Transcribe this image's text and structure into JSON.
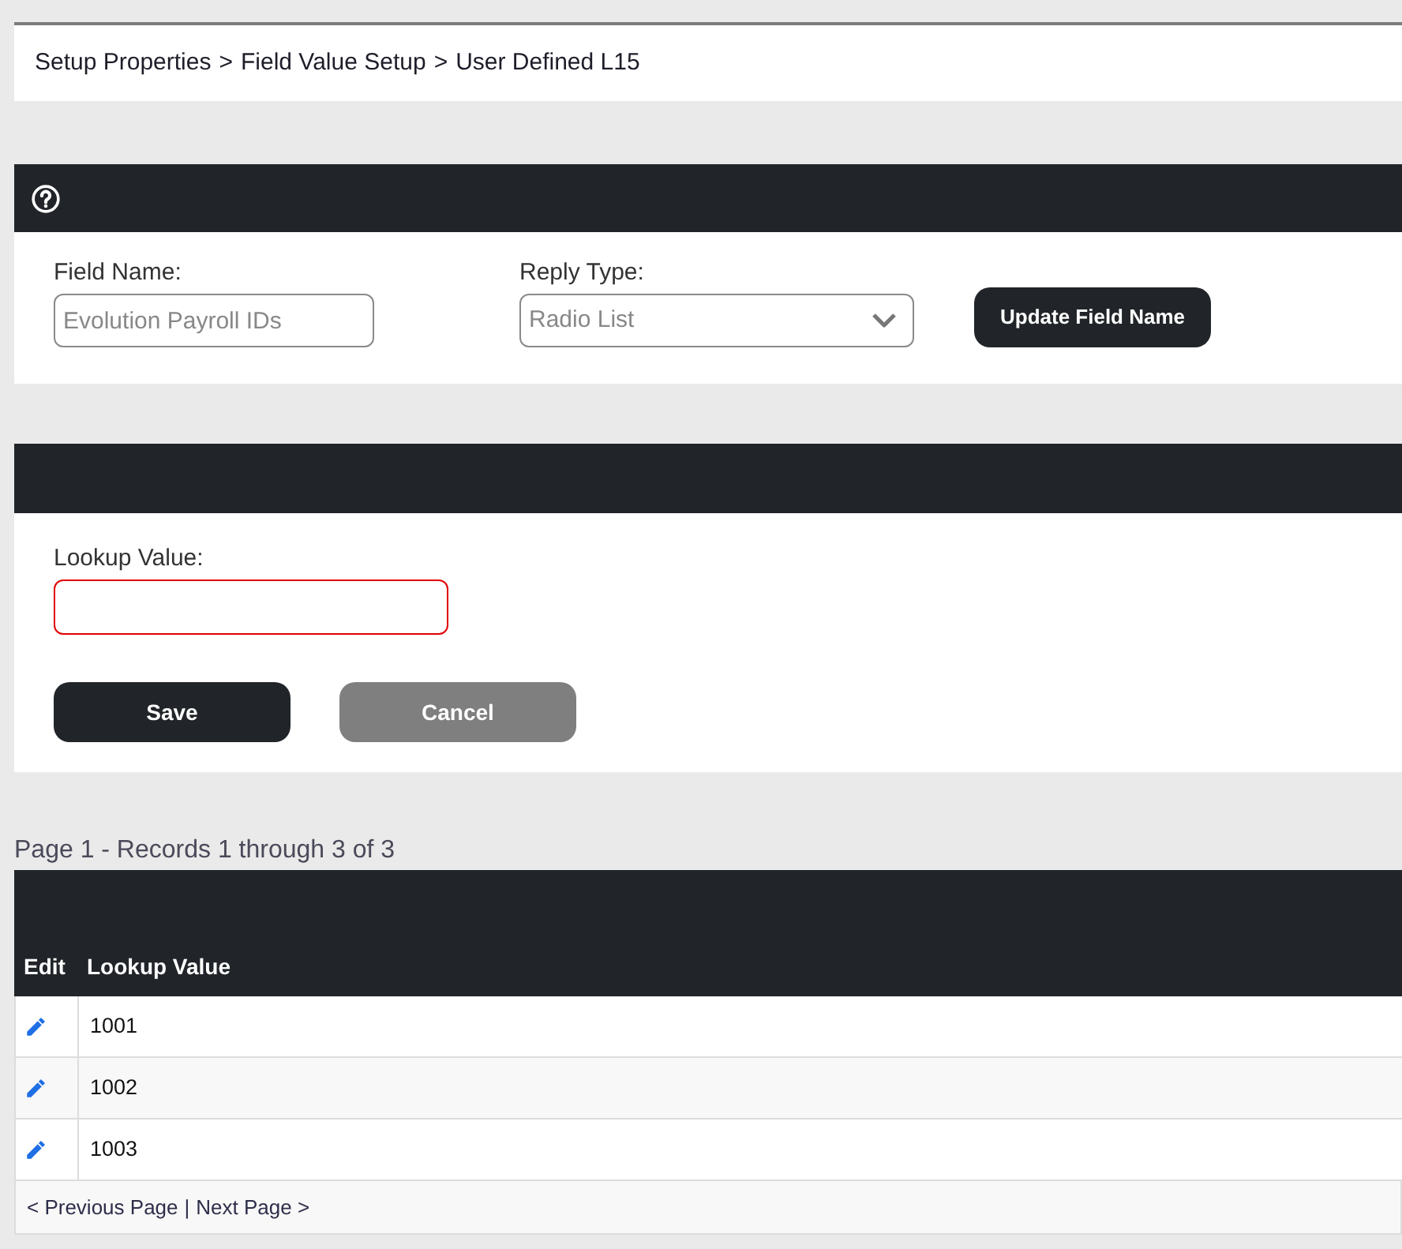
{
  "breadcrumb": [
    {
      "label": "Setup Properties",
      "separator": ">"
    },
    {
      "label": "Field Value Setup",
      "separator": ">"
    },
    {
      "label": "User Defined L15"
    }
  ],
  "field_panel": {
    "field_name": {
      "label": "Field Name:",
      "value": "Evolution Payroll IDs"
    },
    "reply_type": {
      "label": "Reply Type:",
      "value": "Radio List"
    },
    "button": "Update Field Name"
  },
  "lookup_panel": {
    "lookup_value": {
      "label": "Lookup Value:",
      "invalid": true
    },
    "buttons": [
      {
        "label": "Save",
        "kind": "primary"
      },
      {
        "label": "Cancel",
        "kind": "secondary"
      }
    ]
  },
  "records": {
    "summary": "Page 1 - Records 1 through 3 of 3",
    "columns": [
      "Edit",
      "Lookup Value"
    ],
    "rows": [
      {
        "lookup_value": "1001"
      },
      {
        "lookup_value": "1002"
      },
      {
        "lookup_value": "1003"
      }
    ],
    "pager": {
      "previous": "< Previous Page",
      "separator": "|",
      "next": "Next Page >"
    }
  }
}
